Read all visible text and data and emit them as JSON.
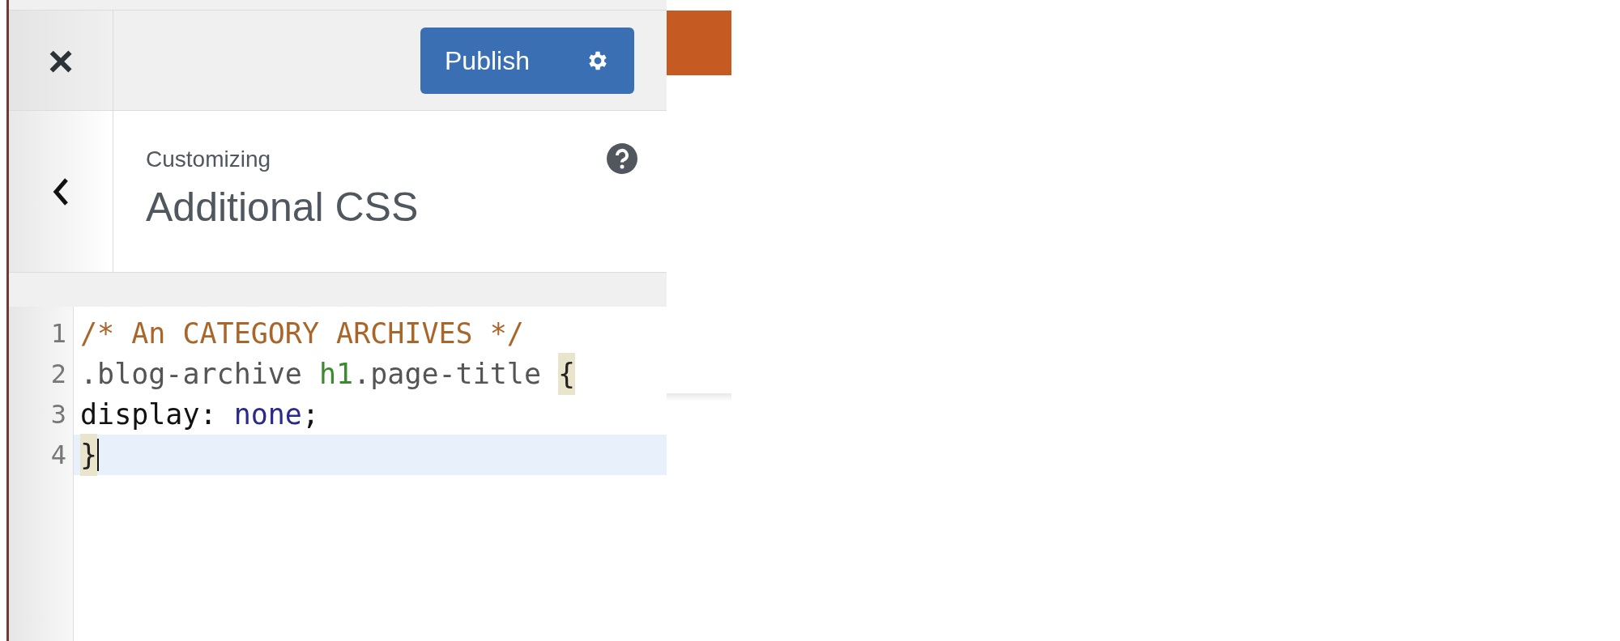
{
  "header": {
    "close_label": "×",
    "publish_button": "Publish"
  },
  "section": {
    "subtitle": "Customizing",
    "title": "Additional CSS"
  },
  "editor": {
    "lines": [
      {
        "number": "1",
        "active": false,
        "tokens": [
          {
            "kind": "comment",
            "text": "/* An CATEGORY ARCHIVES */"
          }
        ]
      },
      {
        "number": "2",
        "active": false,
        "tokens": [
          {
            "kind": "plain",
            "text": ".blog-archive "
          },
          {
            "kind": "tag",
            "text": "h1"
          },
          {
            "kind": "plain",
            "text": ".page-title "
          },
          {
            "kind": "bracket",
            "text": "{"
          }
        ]
      },
      {
        "number": "3",
        "active": false,
        "tokens": [
          {
            "kind": "property",
            "text": "display: "
          },
          {
            "kind": "value",
            "text": "none"
          },
          {
            "kind": "property",
            "text": ";"
          }
        ]
      },
      {
        "number": "4",
        "active": true,
        "tokens": [
          {
            "kind": "bracket",
            "text": "}"
          }
        ]
      }
    ]
  }
}
